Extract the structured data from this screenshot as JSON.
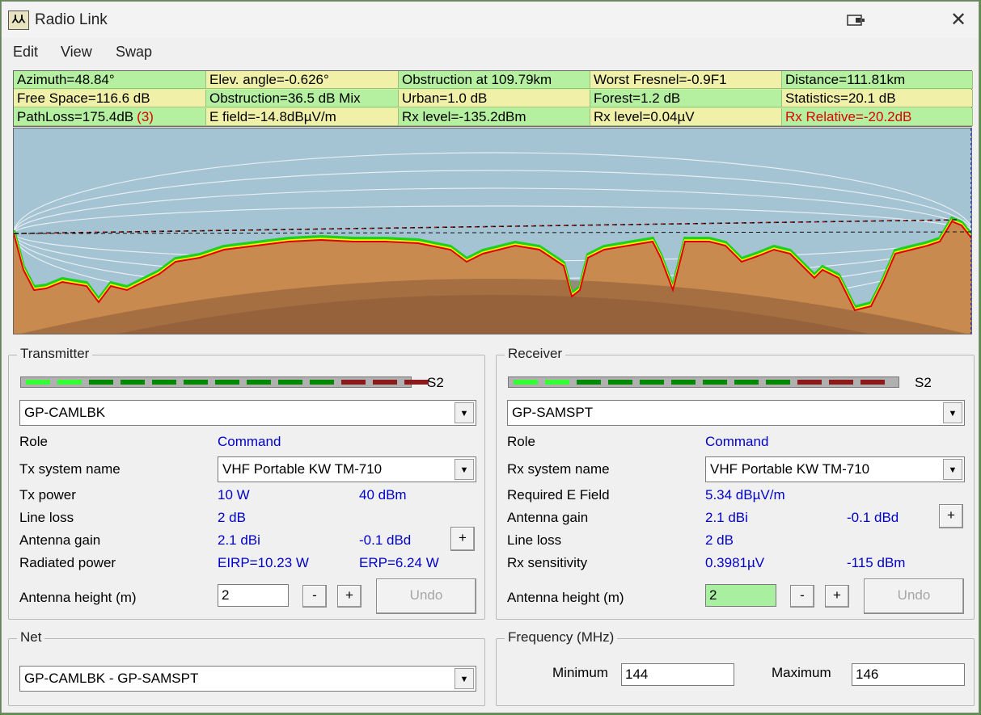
{
  "window": {
    "title": "Radio Link"
  },
  "menu": {
    "edit": "Edit",
    "view": "View",
    "swap": "Swap"
  },
  "info": [
    [
      {
        "text": "Azimuth=48.84°",
        "tone": "green"
      },
      {
        "text": "Elev. angle=-0.626°",
        "tone": "yellow"
      },
      {
        "text": "Obstruction at 109.79km",
        "tone": "green"
      },
      {
        "text": "Worst Fresnel=-0.9F1",
        "tone": "yellow"
      },
      {
        "text": "Distance=111.81km",
        "tone": "green"
      }
    ],
    [
      {
        "text": "Free Space=116.6 dB",
        "tone": "yellow"
      },
      {
        "text": "Obstruction=36.5 dB Mix",
        "tone": "green"
      },
      {
        "text": "Urban=1.0 dB",
        "tone": "yellow"
      },
      {
        "text": "Forest=1.2 dB",
        "tone": "green"
      },
      {
        "text": "Statistics=20.1 dB",
        "tone": "yellow"
      }
    ],
    [
      {
        "text": "PathLoss=175.4dB",
        "extra": "(3)",
        "tone": "green"
      },
      {
        "text": "E field=-14.8dBµV/m",
        "tone": "yellow"
      },
      {
        "text": "Rx level=-135.2dBm",
        "tone": "green"
      },
      {
        "text": "Rx level=0.04µV",
        "tone": "yellow"
      },
      {
        "text": "Rx Relative=-20.2dB",
        "tone": "green",
        "red": true
      }
    ]
  ],
  "colors": {
    "sky": "#a4c3d3",
    "terrain": "#c88a4e",
    "earth_bulge": "#8a5a38",
    "clutter_green": "#1fd11f",
    "clutter_yellow": "#f5f500",
    "profile_red": "#e00000",
    "meter_light": "#33ff33",
    "meter_dark": "#008800",
    "meter_red": "#8b1a1a"
  },
  "transmitter": {
    "title": "Transmitter",
    "meter_label": "S2",
    "meter_segments": [
      "light",
      "light",
      "dark",
      "dark",
      "dark",
      "dark",
      "dark",
      "dark",
      "dark",
      "dark",
      "red",
      "red",
      "red"
    ],
    "unit": "GP-CAMLBK",
    "role_label": "Role",
    "role_value": "Command",
    "system_label": "Tx system name",
    "system_value": "VHF Portable KW TM-710",
    "power_label": "Tx power",
    "power_w": "10 W",
    "power_dbm": "40 dBm",
    "lineloss_label": "Line loss",
    "lineloss_value": "2 dB",
    "gain_label": "Antenna gain",
    "gain_dbi": "2.1 dBi",
    "gain_dbd": "-0.1 dBd",
    "radiated_label": "Radiated power",
    "eirp": "EIRP=10.23 W",
    "erp": "ERP=6.24 W",
    "height_label": "Antenna height (m)",
    "height_value": "2",
    "minus": "-",
    "plus": "+",
    "undo": "Undo"
  },
  "receiver": {
    "title": "Receiver",
    "meter_label": "S2",
    "meter_segments": [
      "light",
      "light",
      "dark",
      "dark",
      "dark",
      "dark",
      "dark",
      "dark",
      "dark",
      "red",
      "red",
      "red"
    ],
    "unit": "GP-SAMSPT",
    "role_label": "Role",
    "role_value": "Command",
    "system_label": "Rx system name",
    "system_value": "VHF Portable KW TM-710",
    "efield_label": "Required E Field",
    "efield_value": "5.34 dBµV/m",
    "gain_label": "Antenna gain",
    "gain_dbi": "2.1 dBi",
    "gain_dbd": "-0.1 dBd",
    "lineloss_label": "Line loss",
    "lineloss_value": "2 dB",
    "sens_label": "Rx sensitivity",
    "sens_uv": "0.3981µV",
    "sens_dbm": "-115 dBm",
    "height_label": "Antenna height (m)",
    "height_value": "2",
    "minus": "-",
    "plus": "+",
    "undo": "Undo"
  },
  "net": {
    "title": "Net",
    "value": "GP-CAMLBK - GP-SAMSPT"
  },
  "frequency": {
    "title": "Frequency (MHz)",
    "min_label": "Minimum",
    "min_value": "144",
    "max_label": "Maximum",
    "max_value": "146"
  }
}
